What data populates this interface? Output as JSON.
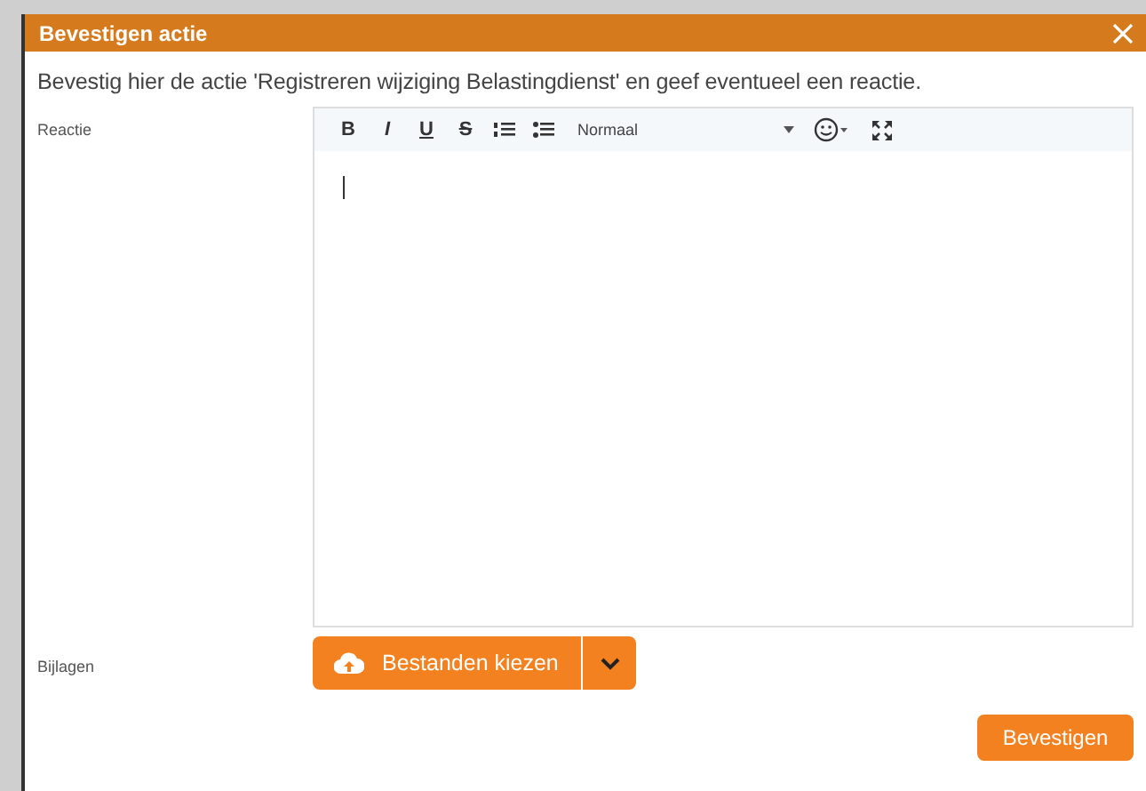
{
  "dialog": {
    "title": "Bevestigen actie",
    "message": "Bevestig hier de actie 'Registreren wijziging Belastingdienst' en geef eventueel een reactie."
  },
  "reaction": {
    "label": "Reactie",
    "format_buttons": [
      {
        "kind": "bold",
        "text": "B"
      },
      {
        "kind": "italic",
        "text": "I"
      },
      {
        "kind": "underline",
        "text": "U"
      },
      {
        "kind": "strike",
        "text": "S"
      }
    ],
    "style_select": "Normaal"
  },
  "attachments": {
    "label": "Bijlagen",
    "button": "Bestanden kiezen"
  },
  "confirm_button": "Bevestigen"
}
